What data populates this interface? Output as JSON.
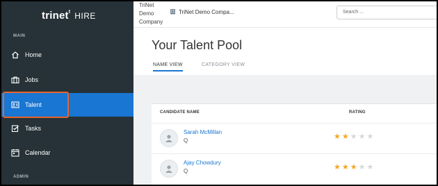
{
  "brand": {
    "name": "trinet",
    "superscript": "t",
    "product": "HIRE"
  },
  "sidebar": {
    "sections": [
      {
        "label": "MAIN"
      },
      {
        "label": "ADMIN"
      }
    ],
    "items": [
      {
        "label": "Home",
        "icon": "home-icon"
      },
      {
        "label": "Jobs",
        "icon": "briefcase-icon"
      },
      {
        "label": "Talent",
        "icon": "id-card-icon",
        "active": true
      },
      {
        "label": "Tasks",
        "icon": "tasks-icon"
      },
      {
        "label": "Calendar",
        "icon": "calendar-icon"
      }
    ]
  },
  "topbar": {
    "company_image_alt": [
      "TriNet",
      "Demo",
      "Company"
    ],
    "company_name": "TriNet Demo Compa...",
    "search_placeholder": "Search ..."
  },
  "main": {
    "title": "Your Talent Pool",
    "tabs": [
      {
        "label": "NAME VIEW",
        "active": true
      },
      {
        "label": "CATEGORY VIEW",
        "active": false
      }
    ],
    "table": {
      "columns": [
        "CANDIDATE NAME",
        "RATING"
      ],
      "rows": [
        {
          "name": "Sarah McMillan",
          "sub_icon": "Q",
          "rating": 2,
          "max": 5
        },
        {
          "name": "Ajay Chowdury",
          "sub_icon": "Q",
          "rating": 3,
          "max": 5
        }
      ]
    }
  },
  "colors": {
    "sidebar": "#263238",
    "accent": "#1976d2",
    "highlight": "#e8642a",
    "star": "#f5a623"
  }
}
